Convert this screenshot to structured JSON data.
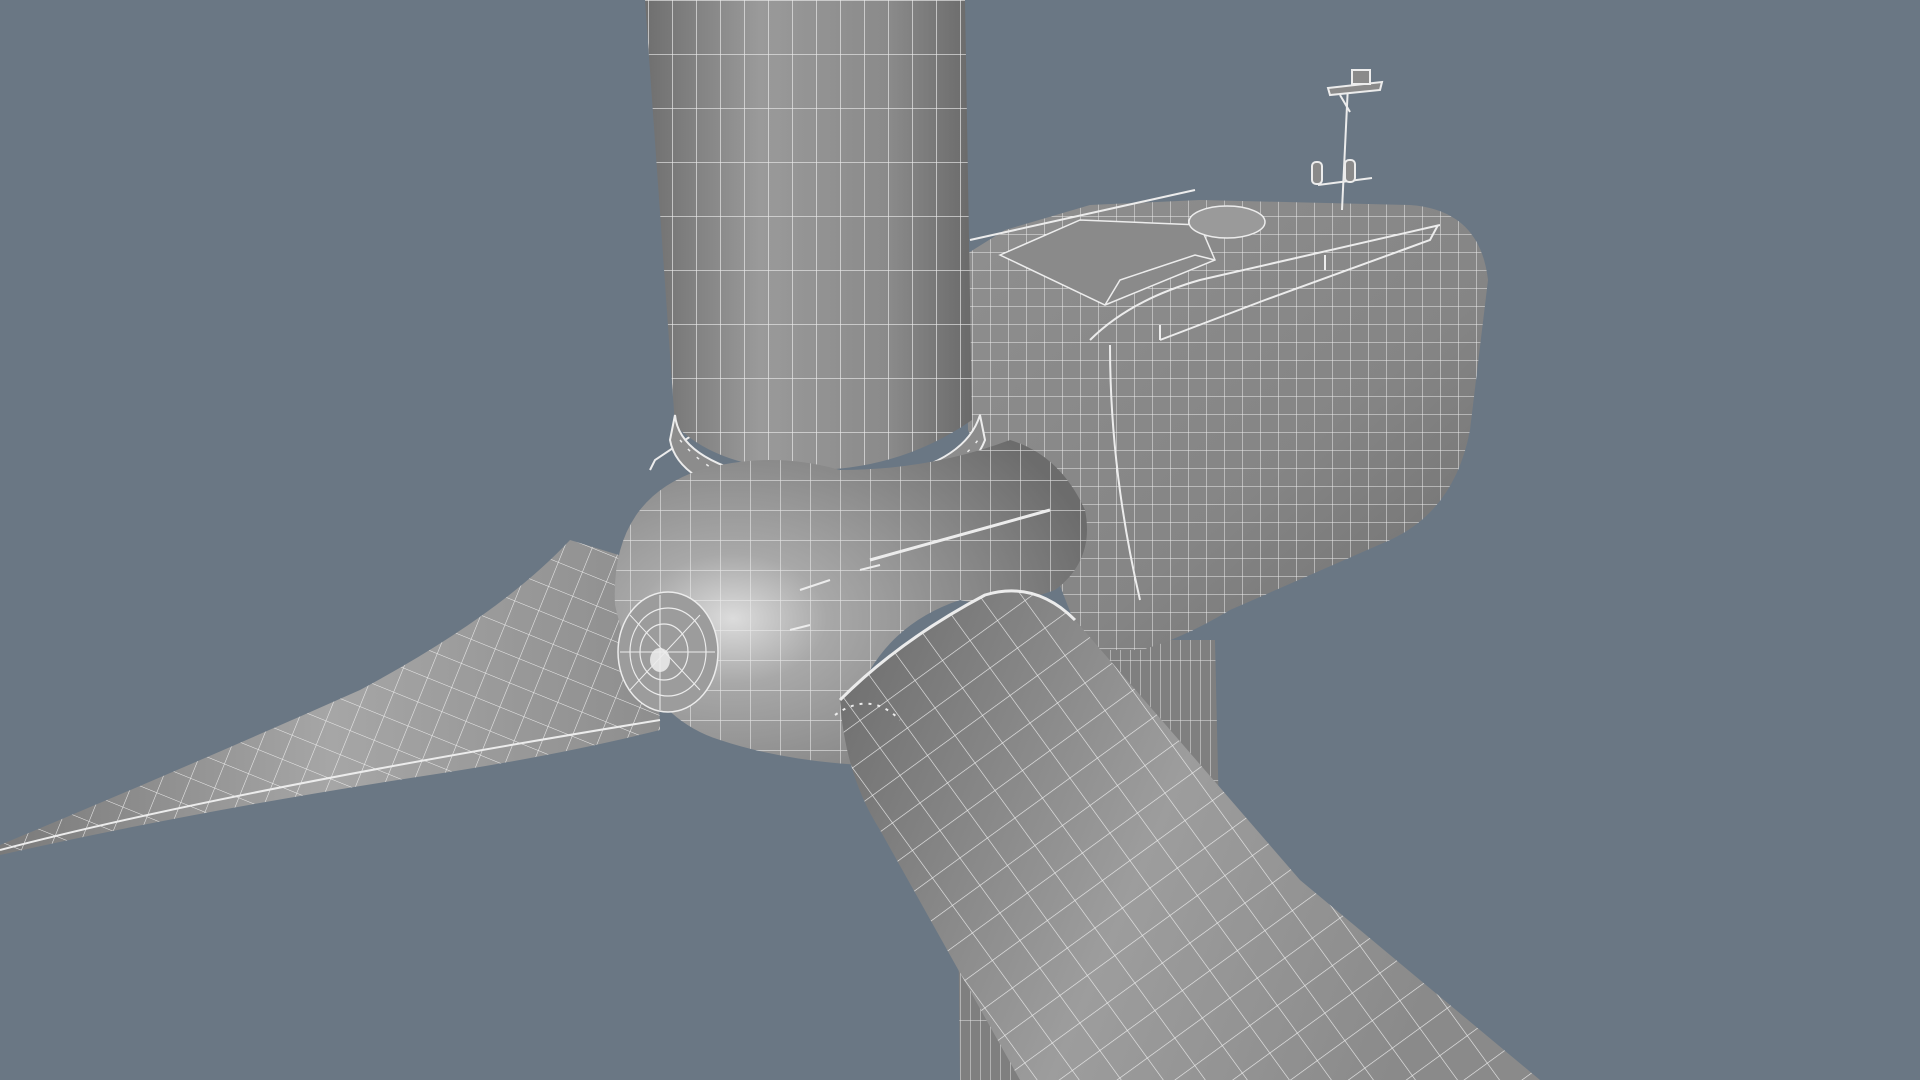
{
  "viewport": {
    "background_color": "#6a7784",
    "shading_color": "#8e8e8e",
    "wireframe_color": "#ececec",
    "highlight_color": "#c6c6c6",
    "shadow_color": "#5c5c5c",
    "render_mode": "shaded-wireframe"
  },
  "model": {
    "parts": [
      "tower",
      "nacelle",
      "hub",
      "spinner",
      "blade-upper",
      "blade-left",
      "blade-lower",
      "railing",
      "sensor-mast",
      "roof-hatch",
      "pitch-bearing"
    ]
  }
}
